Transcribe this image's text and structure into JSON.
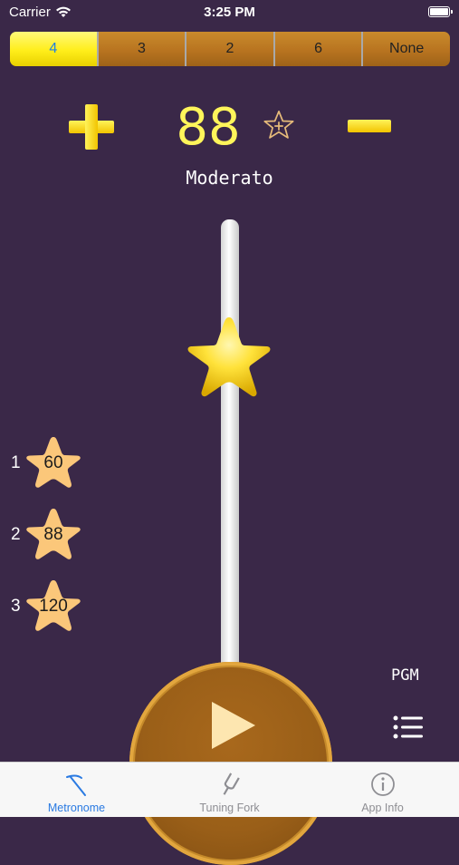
{
  "status_bar": {
    "carrier": "Carrier",
    "time": "3:25 PM"
  },
  "beats": {
    "options": [
      "4",
      "3",
      "2",
      "6",
      "None"
    ],
    "selected": "4"
  },
  "tempo": {
    "bpm": "88",
    "marking": "Moderato"
  },
  "presets": [
    {
      "index": "1",
      "bpm": "60"
    },
    {
      "index": "2",
      "bpm": "88"
    },
    {
      "index": "3",
      "bpm": "120"
    }
  ],
  "pgm_label": "PGM",
  "tabs": [
    {
      "label": "Metronome",
      "icon": "metronome-icon",
      "active": true
    },
    {
      "label": "Tuning Fork",
      "icon": "tuning-fork-icon",
      "active": false
    },
    {
      "label": "App Info",
      "icon": "info-icon",
      "active": false
    }
  ],
  "colors": {
    "background": "#3a2848",
    "accent_yellow": "#fff55a",
    "segment_orange": "#b87420",
    "tab_active": "#2a7ae2"
  }
}
